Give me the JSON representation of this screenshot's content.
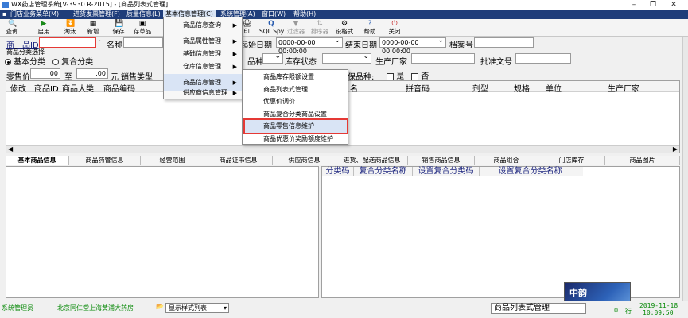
{
  "window": {
    "title": "WX药店管理系统[V-3930 R-2015] - [商品列表式管理]",
    "controls": [
      "–",
      "❐",
      "✕"
    ]
  },
  "menubar": {
    "items": [
      "门店业务菜单(M)",
      "进货发票管理(F)",
      "质量信息(L)",
      "基本信息管理(C)",
      "系统管理(A)",
      "窗口(W)",
      "帮助(H)"
    ]
  },
  "toolbar": {
    "items": [
      {
        "label": "查询",
        "icon": "🔍"
      },
      {
        "label": "启用",
        "icon": "▶"
      },
      {
        "label": "淘汰",
        "icon": "⏬"
      },
      {
        "label": "新增",
        "icon": "▦"
      },
      {
        "label": "保存",
        "icon": "💾"
      },
      {
        "label": "存草品",
        "icon": "▣"
      }
    ],
    "items2": [
      {
        "label": "印",
        "icon": "🖨",
        "disabled": false
      },
      {
        "label": "SQL Spy",
        "icon": "Q",
        "disabled": false
      },
      {
        "label": "过滤器",
        "icon": "▼",
        "disabled": true
      },
      {
        "label": "排序器",
        "icon": "⇅",
        "disabled": true
      },
      {
        "label": "设格式",
        "icon": "⚙",
        "disabled": false
      },
      {
        "label": "帮助",
        "icon": "?",
        "disabled": false
      },
      {
        "label": "关闭",
        "icon": "⏻",
        "disabled": false
      }
    ]
  },
  "form": {
    "product_id_label": "商　品ID",
    "name_label": "名称",
    "start_date_label": "起始日期",
    "start_date_value": "0000-00-00 00:00:00",
    "end_date_label": "结束日期",
    "end_date_value": "0000-00-00 00:00:00",
    "archive_label": "档案号",
    "category_group": "商品分类选择",
    "basic_category": "基本分类",
    "compound_category": "复合分类",
    "variety_label": "品种",
    "stock_status_label": "库存状态",
    "manufacturer_label": "生产厂家",
    "approval_label": "批准文号",
    "price_label": "零售价",
    "price_from": ".00",
    "price_to_label": "至",
    "price_to": ".00",
    "price_unit": "元",
    "sales_type_label": "销售类型",
    "medical_label": "医保品种:",
    "yes": "是",
    "no": "否"
  },
  "grid": {
    "columns": [
      "修改",
      "商品ID",
      "商品大类",
      "商品编码",
      "名",
      "拼音码",
      "剂型",
      "规格",
      "单位",
      "生产厂家"
    ]
  },
  "tabs": [
    "基本商品信息",
    "商品药管信息",
    "经营范围",
    "商品证书信息",
    "供应商信息",
    "进货、配送商品信息",
    "销售商品信息",
    "商品组合",
    "门店库存",
    "商品图片"
  ],
  "right_grid": {
    "columns": [
      "分类码",
      "复合分类名称",
      "设置复合分类码",
      "设置复合分类名称"
    ]
  },
  "menu_main": {
    "items": [
      {
        "label": "商品信息查询",
        "submenu": true
      },
      {
        "label": "商品属性管理",
        "submenu": true
      },
      {
        "label": "基础信息管理",
        "submenu": true
      },
      {
        "label": "仓库信息管理",
        "submenu": true
      },
      {
        "label": "商品信息管理",
        "submenu": true
      },
      {
        "label": "供应商信息管理",
        "submenu": true
      }
    ]
  },
  "menu_sub": {
    "items": [
      "商品库存限额设置",
      "商品列表式管理",
      "优惠价调价",
      "商品复合分类商品设置",
      "商品零售信息维护",
      "商品优惠价奖励额度维护"
    ]
  },
  "status": {
    "user": "系统管理员",
    "store": "北京同仁堂上海黄浦大药房",
    "view_label": "显示样式列表",
    "module": "商品列表式管理",
    "date": "2019-11-18",
    "time": "10:09:50",
    "extra1": "0",
    "extra2": "行"
  },
  "avatar": {
    "text": "中韵"
  },
  "colors": {
    "menubar": "#1f3d7a",
    "highlight": "#d9e4f5",
    "accent_red": "#e53935",
    "status_green": "#0a8a0a"
  }
}
